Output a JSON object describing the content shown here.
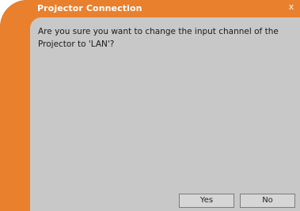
{
  "window": {
    "title": "Projector Connection",
    "close_glyph": "x"
  },
  "dialog": {
    "message": "Are you sure you want to change the input channel of the Projector to 'LAN'?"
  },
  "buttons": {
    "yes_label": "Yes",
    "no_label": "No"
  },
  "colors": {
    "accent": "#e8802e",
    "panel": "#c8c8c8"
  }
}
